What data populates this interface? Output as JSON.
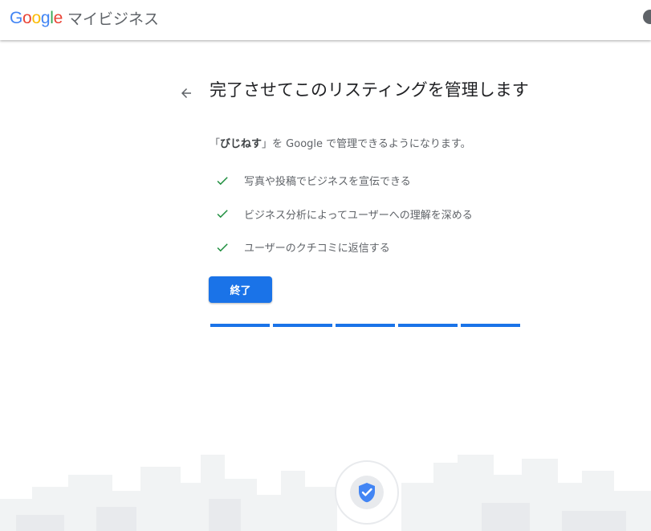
{
  "header": {
    "logo_letters": [
      "G",
      "o",
      "o",
      "g",
      "l",
      "e"
    ],
    "logo_colors": [
      "#4285F4",
      "#EA4335",
      "#FBBC05",
      "#4285F4",
      "#34A853",
      "#EA4335"
    ],
    "product_name": "マイビジネス"
  },
  "main": {
    "title": "完了させてこのリスティングを管理します",
    "description": {
      "open_bracket": "「",
      "business_name": "びじねす",
      "rest": "」を Google で管理できるようになります。"
    },
    "features": [
      {
        "icon": "check-icon",
        "label": "写真や投稿でビジネスを宣伝できる"
      },
      {
        "icon": "check-icon",
        "label": "ビジネス分析によってユーザーへの理解を深める"
      },
      {
        "icon": "check-icon",
        "label": "ユーザーのクチコミに返信する"
      }
    ],
    "done_label": "終了",
    "progress": {
      "completed_steps": 5,
      "total_steps": 5
    }
  },
  "colors": {
    "accent": "#1a73e8",
    "check": "#1e8e3e",
    "shield": "#4285f4"
  }
}
